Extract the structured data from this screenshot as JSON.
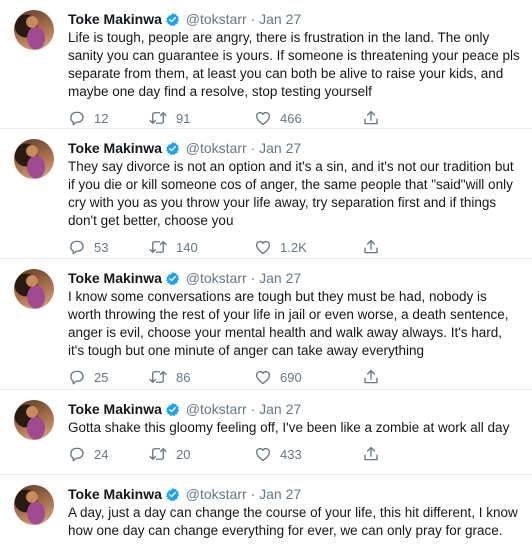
{
  "tweets": [
    {
      "name": "Toke Makinwa",
      "handle": "@tokstarr",
      "date": "Jan 27",
      "text": "Life is tough, people are angry, there is frustration in the land. The only sanity you can guarantee is yours. If someone is threatening your peace pls separate from them, at least you can both be alive to raise your kids, and maybe one day find a resolve, stop testing yourself",
      "replies": "12",
      "retweets": "91",
      "likes": "466"
    },
    {
      "name": "Toke Makinwa",
      "handle": "@tokstarr",
      "date": "Jan 27",
      "text": "They say divorce is not an option and it's a sin, and it's not our tradition but if you die or kill someone cos of anger, the same people that \"said\"will only cry with you as you throw your life away, try separation first and if things don't get better, choose you",
      "replies": "53",
      "retweets": "140",
      "likes": "1.2K"
    },
    {
      "name": "Toke Makinwa",
      "handle": "@tokstarr",
      "date": "Jan 27",
      "text": "I know some conversations are tough but they must be had, nobody is worth throwing the rest of your life in jail or even worse, a death sentence, anger is evil, choose your mental health and walk away always. It's hard, it's tough but one minute of anger can take away everything",
      "replies": "25",
      "retweets": "86",
      "likes": "690"
    },
    {
      "name": "Toke Makinwa",
      "handle": "@tokstarr",
      "date": "Jan 27",
      "text": "Gotta shake this gloomy feeling off, I've been like a zombie at work all day",
      "replies": "24",
      "retweets": "20",
      "likes": "433"
    },
    {
      "name": "Toke Makinwa",
      "handle": "@tokstarr",
      "date": "Jan 27",
      "text": "A day, just a day can change the course of your life, this hit different, I know how one day can change everything for ever, we can only pray for grace.",
      "replies": "",
      "retweets": "",
      "likes": ""
    }
  ],
  "separator": "·",
  "icons": {
    "verified": "verified-badge-icon",
    "reply": "reply-icon",
    "retweet": "retweet-icon",
    "like": "heart-icon",
    "share": "share-icon"
  },
  "colors": {
    "verified": "#1da1f2",
    "text": "#14171a",
    "muted": "#657786",
    "divider": "#e6ecf0"
  }
}
